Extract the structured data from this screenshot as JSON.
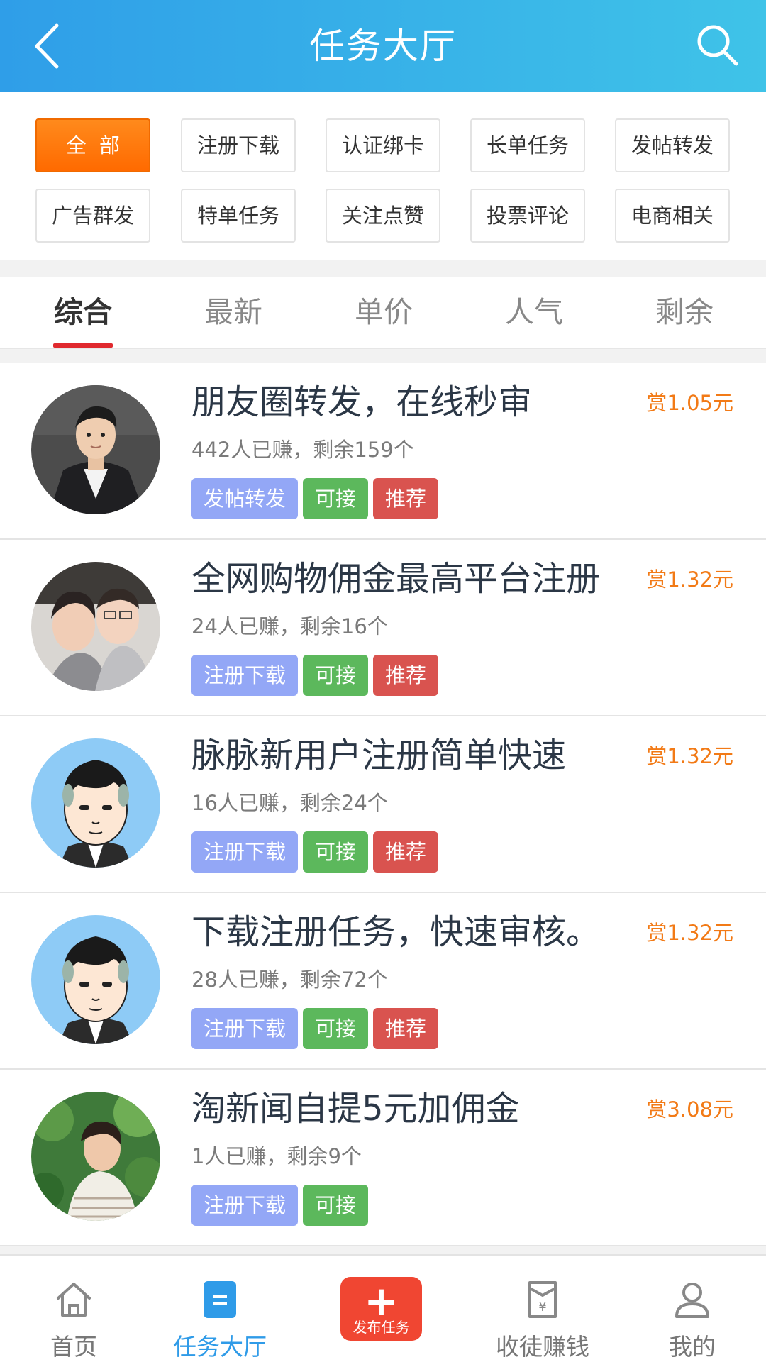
{
  "header": {
    "title": "任务大厅",
    "back_icon": "chevron-left-icon",
    "search_icon": "search-icon",
    "gradient": [
      "#2f9ee8",
      "#3fc3e8"
    ]
  },
  "categories": [
    {
      "label": "全部",
      "active": true
    },
    {
      "label": "注册下载",
      "active": false
    },
    {
      "label": "认证绑卡",
      "active": false
    },
    {
      "label": "长单任务",
      "active": false
    },
    {
      "label": "发帖转发",
      "active": false
    },
    {
      "label": "广告群发",
      "active": false
    },
    {
      "label": "特单任务",
      "active": false
    },
    {
      "label": "关注点赞",
      "active": false
    },
    {
      "label": "投票评论",
      "active": false
    },
    {
      "label": "电商相关",
      "active": false
    }
  ],
  "sort_tabs": [
    {
      "label": "综合",
      "active": true
    },
    {
      "label": "最新",
      "active": false
    },
    {
      "label": "单价",
      "active": false
    },
    {
      "label": "人气",
      "active": false
    },
    {
      "label": "剩余",
      "active": false
    }
  ],
  "tasks": [
    {
      "title": "朋友圈转发，在线秒审",
      "stats": "442人已赚，剩余159个",
      "reward": "赏1.05元",
      "tags": [
        {
          "label": "发帖转发",
          "color": "blue"
        },
        {
          "label": "可接",
          "color": "green"
        },
        {
          "label": "推荐",
          "color": "red"
        }
      ],
      "avatar": "man-in-suit-photo"
    },
    {
      "title": "全网购物佣金最高平台注册",
      "stats": "24人已赚，剩余16个",
      "reward": "赏1.32元",
      "tags": [
        {
          "label": "注册下载",
          "color": "blue"
        },
        {
          "label": "可接",
          "color": "green"
        },
        {
          "label": "推荐",
          "color": "red"
        }
      ],
      "avatar": "couple-photo"
    },
    {
      "title": "脉脉新用户注册简单快速",
      "stats": "16人已赚，剩余24个",
      "reward": "赏1.32元",
      "tags": [
        {
          "label": "注册下载",
          "color": "blue"
        },
        {
          "label": "可接",
          "color": "green"
        },
        {
          "label": "推荐",
          "color": "red"
        }
      ],
      "avatar": "cartoon-man-avatar"
    },
    {
      "title": "下载注册任务，快速审核。",
      "stats": "28人已赚，剩余72个",
      "reward": "赏1.32元",
      "tags": [
        {
          "label": "注册下载",
          "color": "blue"
        },
        {
          "label": "可接",
          "color": "green"
        },
        {
          "label": "推荐",
          "color": "red"
        }
      ],
      "avatar": "cartoon-man-avatar"
    },
    {
      "title": "淘新闻自提5元加佣金",
      "stats": "1人已赚，剩余9个",
      "reward": "赏3.08元",
      "tags": [
        {
          "label": "注册下载",
          "color": "blue"
        },
        {
          "label": "可接",
          "color": "green"
        }
      ],
      "avatar": "woman-in-garden-photo"
    }
  ],
  "bottom_nav": {
    "items": [
      {
        "label": "首页",
        "icon": "home-icon",
        "active": false
      },
      {
        "label": "任务大厅",
        "icon": "task-hall-icon",
        "active": true
      },
      {
        "label": "收徒赚钱",
        "icon": "money-bag-icon",
        "active": false
      },
      {
        "label": "我的",
        "icon": "user-icon",
        "active": false
      }
    ],
    "publish": {
      "label": "发布任务",
      "symbol": "+"
    }
  },
  "colors": {
    "accent_blue": "#2f9be8",
    "orange": "#ff6a00",
    "reward": "#f27a16",
    "tab_underline": "#e0292e",
    "tag_blue": "#93a7f6",
    "tag_green": "#5cb85c",
    "tag_red": "#d9534f",
    "publish_red": "#f04632"
  }
}
